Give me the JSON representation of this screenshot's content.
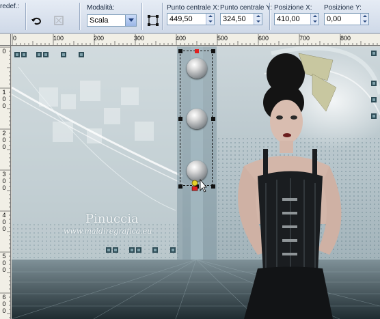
{
  "toolbar": {
    "preset_label": "redef.:",
    "mode_label": "Modalità:",
    "mode_value": "Scala",
    "center_x_label": "Punto centrale X:",
    "center_x_value": "449,50",
    "center_y_label": "Punto centrale Y:",
    "center_y_value": "324,50",
    "pos_x_label": "Posizione X:",
    "pos_x_value": "410,00",
    "pos_y_label": "Posizione Y:",
    "pos_y_value": "0,00",
    "icons": [
      "undo-arrow-icon",
      "reset-icon",
      "pick-tool-icon"
    ]
  },
  "ruler_top": {
    "labels": [
      "0",
      "100",
      "200",
      "300",
      "400",
      "500",
      "600",
      "700",
      "800"
    ]
  },
  "ruler_left": {
    "labels": [
      "0",
      "1",
      "0",
      "0",
      "2",
      "0",
      "0",
      "3",
      "0",
      "0",
      "4",
      "0",
      "0",
      "5",
      "0",
      "0",
      "6",
      "0",
      "0"
    ]
  },
  "canvas": {
    "watermark_title": "Pinuccia",
    "watermark_url": "www.maidiregrafica.eu",
    "colors": {
      "accent": "#b7c6cc",
      "watermark": "#ffffff"
    }
  }
}
